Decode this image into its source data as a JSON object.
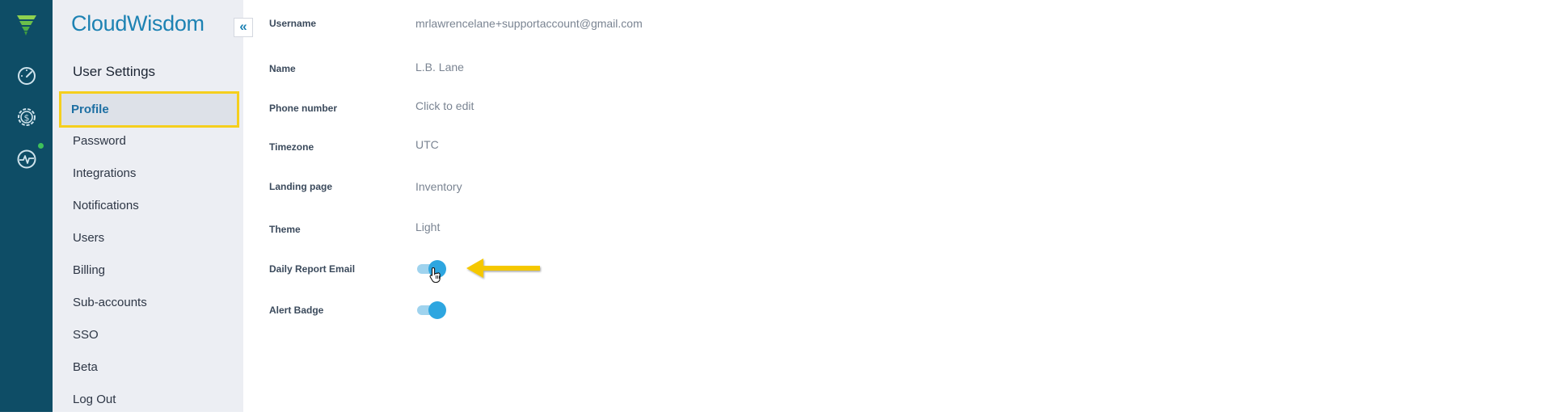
{
  "app": {
    "brand": "CloudWisdom"
  },
  "rail": {
    "icons": [
      "logo-icon",
      "dashboard-gauge-icon",
      "cost-gear-dollar-icon",
      "monitoring-pulse-icon"
    ],
    "status_color": "#3ec15a"
  },
  "sidebar": {
    "collapse_label": "«",
    "section_title": "User Settings",
    "items": [
      {
        "label": "Profile",
        "active": true
      },
      {
        "label": "Password"
      },
      {
        "label": "Integrations"
      },
      {
        "label": "Notifications"
      },
      {
        "label": "Users"
      },
      {
        "label": "Billing"
      },
      {
        "label": "Sub-accounts"
      },
      {
        "label": "SSO"
      },
      {
        "label": "Beta"
      },
      {
        "label": "Log Out"
      }
    ]
  },
  "profile": {
    "username": {
      "label": "Username",
      "value": "mrlawrencelane+supportaccount@gmail.com"
    },
    "name": {
      "label": "Name",
      "value": "L.B. Lane"
    },
    "phone": {
      "label": "Phone number",
      "value": "Click to edit"
    },
    "timezone": {
      "label": "Timezone",
      "value": "UTC"
    },
    "landing_page": {
      "label": "Landing page",
      "value": "Inventory"
    },
    "theme": {
      "label": "Theme",
      "value": "Light"
    },
    "daily_report_email": {
      "label": "Daily Report Email",
      "enabled": true
    },
    "alert_badge": {
      "label": "Alert Badge",
      "enabled": true
    }
  },
  "colors": {
    "rail_bg": "#0e4d66",
    "accent": "#1d82b3",
    "toggle_on": "#2ea6e0",
    "highlight": "#f5cf1d"
  }
}
